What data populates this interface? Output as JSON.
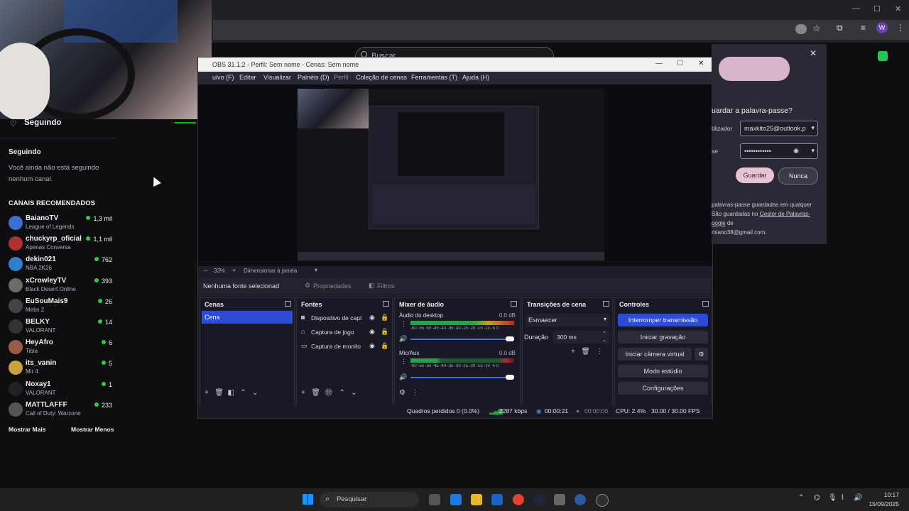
{
  "browser": {
    "search_placeholder": "Buscar",
    "profile_initial": "W",
    "window_minimize": "—",
    "window_maximize": "☐",
    "window_close": "✕"
  },
  "sidebar": {
    "following_header": "Seguindo",
    "following_section": "Seguindo",
    "not_following_text": "Você ainda não está seguindo nenhum canal.",
    "recommended_header": "CANAIS RECOMENDADOS",
    "channels": [
      {
        "name": "BaianoTV",
        "game": "League of Legends",
        "viewers": "1,3 mil",
        "color": "#3b6fd0"
      },
      {
        "name": "chuckyrp_oficial",
        "game": "Apenas Conversa",
        "viewers": "1,1 mil",
        "color": "#b03030"
      },
      {
        "name": "dekin021",
        "game": "NBA 2K26",
        "viewers": "762",
        "color": "#2f7fcf"
      },
      {
        "name": "xCrowleyTV",
        "game": "Black Desert Online",
        "viewers": "393",
        "color": "#6a6a6a"
      },
      {
        "name": "EuSouMais9",
        "game": "Metin 2",
        "viewers": "26",
        "color": "#444444"
      },
      {
        "name": "BELKY",
        "game": "VALORANT",
        "viewers": "14",
        "color": "#333333"
      },
      {
        "name": "HeyAfro",
        "game": "Tibia",
        "viewers": "6",
        "color": "#9a5a4a"
      },
      {
        "name": "its_vanin",
        "game": "Mir 4",
        "viewers": "5",
        "color": "#c9a33c"
      },
      {
        "name": "Noxay1",
        "game": "VALORANT",
        "viewers": "1",
        "color": "#222222"
      },
      {
        "name": "MATTLAFFF",
        "game": "Call of Duty: Warzone",
        "viewers": "233",
        "color": "#555555"
      }
    ],
    "show_more": "Mostrar Mais",
    "show_less": "Mostrar Menos"
  },
  "obs": {
    "title": "OBS 31.1.2 - Perfil: Sem nome - Cenas: Sem nome",
    "menu": [
      "uivo (F)",
      "Editar",
      "Visualizar",
      "Painéis (D)",
      "Perfil",
      "Coleção de cenas",
      "Ferramentas (T)",
      "Ajuda (H)"
    ],
    "zoom": "33%",
    "scale_mode": "Dimensionar à janela",
    "no_source": "Nenhuma fonte selecionad",
    "properties": "Propriedades",
    "filters": "Filtros",
    "scenes_header": "Cenas",
    "scenes": [
      "Cena"
    ],
    "sources_header": "Fontes",
    "sources": [
      "Dispositivo de capt",
      "Captura de jogo",
      "Captura de monito"
    ],
    "mixer_header": "Mixer de áudio",
    "mixer": [
      {
        "name": "Áudio do desktop",
        "db": "0.0 dB",
        "scale": "-60 -55 -50 -45 -40 -35 -30 -25 -20 -15 -10 -5 0"
      },
      {
        "name": "Mic/Aux",
        "db": "0.0 dB",
        "scale": "-60 -55 -50 -45 -40 -35 -30 -25 -20 -15 -10 -5 0"
      }
    ],
    "transitions_header": "Transições de cena",
    "transition_select": "Esmaecer",
    "duration_label": "Duração",
    "duration_value": "300 ms",
    "controls_header": "Controles",
    "controls": {
      "stop_stream": "Interromper transmissão",
      "start_recording": "Iniciar gravação",
      "virtual_cam": "Iniciar câmera virtual",
      "studio_mode": "Modo estúdio",
      "settings": "Configurações"
    },
    "status": {
      "dropped": "Quadros perdidos 0 (0.0%)",
      "bitrate": "2287 kbps",
      "stream_time": "00:00:21",
      "rec_time": "00:00:00",
      "cpu": "CPU: 2.4%",
      "fps": "30.00 / 30.00 FPS"
    }
  },
  "password_popup": {
    "title": "uardar a palavra-passe?",
    "user_label": "tilizador",
    "user_value": "maxkito25@outlook.p",
    "pass_label": "se",
    "pass_value": "••••••••••••",
    "save_button": "Guardar",
    "never_button": "Nunca",
    "info_line1": "palavras-passe guardadas em qualquer",
    "info_line2": "São guardadas no",
    "info_link1": "Gestor de Palavras-",
    "info_link2": "oogle",
    "info_line3": "de",
    "info_line4": "miano38@gmail.com."
  },
  "taskbar": {
    "search": "Pesquisar",
    "time": "10:17",
    "date": "15/09/2025"
  }
}
